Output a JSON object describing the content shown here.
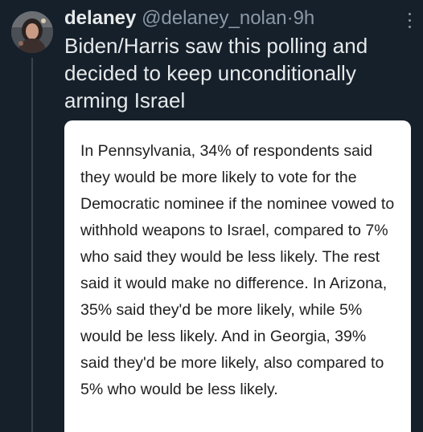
{
  "author": {
    "display_name": "delaney",
    "handle": "@delaney_nolan",
    "separator": "·",
    "time": "9h",
    "avatar_icon": "profile-photo"
  },
  "tweet": {
    "text": "Biden/Harris saw this polling and decided to keep unconditionally arming Israel"
  },
  "quote": {
    "text": "In Pennsylvania, 34% of respondents said they would be more likely to vote for the Democratic nominee if the nominee vowed to withhold weapons to Israel, compared to 7% who said they would be less likely. The rest said it would make no difference. In Arizona, 35% said they'd be more likely, while 5% would be less likely. And in Georgia, 39% said they'd be more likely, also compared to 5% who would be less likely."
  },
  "menu": {
    "icon": "more-vertical-icon"
  },
  "colors": {
    "background": "#15202b",
    "primary_text": "#e7e9ea",
    "secondary_text": "#8b98a5",
    "card_background": "#ffffff",
    "card_text": "#1f1f1f"
  }
}
